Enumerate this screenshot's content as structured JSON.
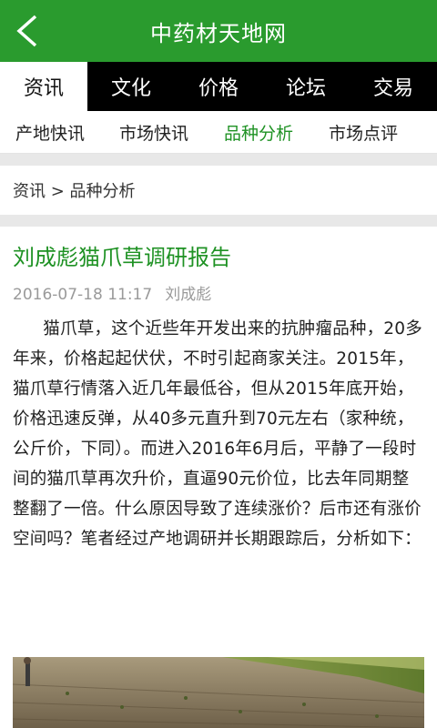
{
  "header": {
    "title": "中药材天地网",
    "back_icon": "chevron-left-icon"
  },
  "main_tabs": [
    {
      "label": "资讯",
      "active": true
    },
    {
      "label": "文化",
      "active": false
    },
    {
      "label": "价格",
      "active": false
    },
    {
      "label": "论坛",
      "active": false
    },
    {
      "label": "交易",
      "active": false
    }
  ],
  "sub_tabs": [
    {
      "label": "产地快讯",
      "active": false
    },
    {
      "label": "市场快讯",
      "active": false
    },
    {
      "label": "品种分析",
      "active": true
    },
    {
      "label": "市场点评",
      "active": false
    }
  ],
  "breadcrumb": {
    "text": "资讯 > 品种分析"
  },
  "article": {
    "title": "刘成彪猫爪草调研报告",
    "datetime": "2016-07-18 11:17",
    "author": "刘成彪",
    "body": "猫爪草，这个近些年开发出来的抗肿瘤品种，20多年来，价格起起伏伏，不时引起商家关注。2015年，猫爪草行情落入近几年最低谷，但从2015年底开始，价格迅速反弹，从40多元直升到70元左右（家种统，公斤价，下同）。而进入2016年6月后，平静了一段时间的猫爪草再次升价，直逼90元价位，比去年同期整整翻了一倍。什么原因导致了连续涨价？后市还有涨价空间吗？笔者经过产地调研并长期跟踪后，分析如下："
  },
  "colors": {
    "brand_green": "#2a9b2e",
    "title_green": "#1f9224",
    "tab_bar": "#000000",
    "meta_gray": "#9a9a9a"
  }
}
